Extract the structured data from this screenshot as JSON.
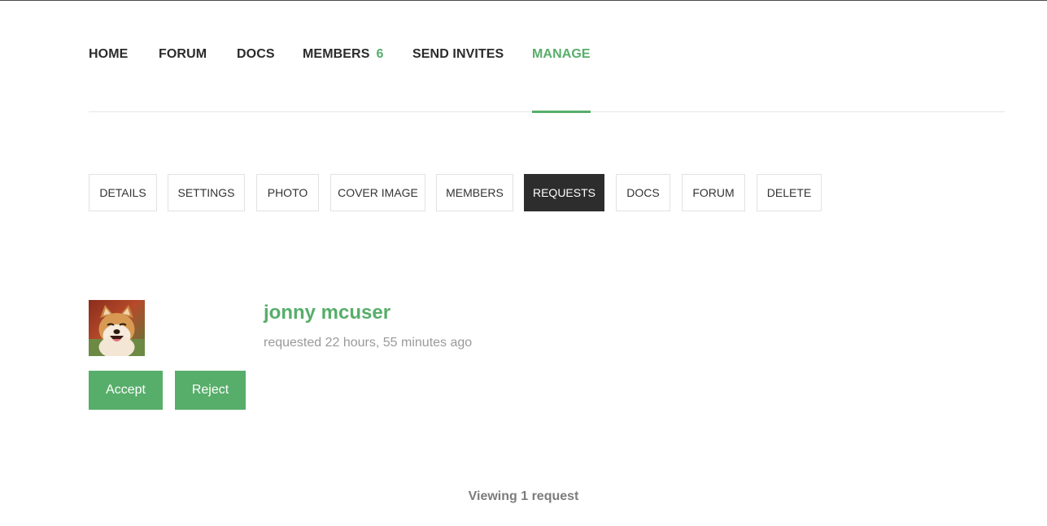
{
  "primary_nav": {
    "items": [
      {
        "label": "HOME"
      },
      {
        "label": "FORUM"
      },
      {
        "label": "DOCS"
      },
      {
        "label": "MEMBERS",
        "count": "6"
      },
      {
        "label": "SEND INVITES"
      },
      {
        "label": "MANAGE",
        "active": true
      }
    ],
    "accent_color": "#57ae6a"
  },
  "sub_nav": {
    "items": [
      {
        "label": "DETAILS"
      },
      {
        "label": "SETTINGS"
      },
      {
        "label": "PHOTO"
      },
      {
        "label": "COVER IMAGE"
      },
      {
        "label": "MEMBERS"
      },
      {
        "label": "REQUESTS",
        "active": true
      },
      {
        "label": "DOCS"
      },
      {
        "label": "FORUM"
      },
      {
        "label": "DELETE"
      }
    ]
  },
  "request": {
    "name": "jonny mcuser",
    "time": "requested 22 hours, 55 minutes ago",
    "avatar": "shiba-inu-dog-avatar",
    "accept_label": "Accept",
    "reject_label": "Reject"
  },
  "footer": {
    "count_text": "Viewing 1 request"
  }
}
